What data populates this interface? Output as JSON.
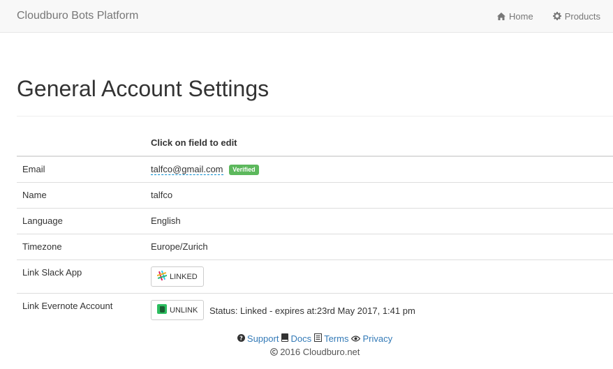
{
  "navbar": {
    "brand": "Cloudburo Bots Platform",
    "home_label": "Home",
    "products_label": "Products"
  },
  "page": {
    "title": "General Account Settings",
    "edit_hint": "Click on field to edit"
  },
  "settings": {
    "email_label": "Email",
    "email_value": "talfco@gmail.com",
    "email_badge": "Verified",
    "name_label": "Name",
    "name_value": "talfco",
    "language_label": "Language",
    "language_value": "English",
    "timezone_label": "Timezone",
    "timezone_value": "Europe/Zurich",
    "slack_label": "Link Slack App",
    "slack_button": "LINKED",
    "evernote_label": "Link Evernote Account",
    "evernote_button": "UNLINK",
    "evernote_status": "Status: Linked - expires at:23rd May 2017, 1:41 pm"
  },
  "footer": {
    "support": "Support",
    "docs": "Docs",
    "terms": "Terms",
    "privacy": "Privacy",
    "copyright": "2016 Cloudburo.net"
  },
  "colors": {
    "badge_green": "#5cb85c",
    "link_blue": "#337ab7",
    "evernote_green": "#2dbe60"
  }
}
